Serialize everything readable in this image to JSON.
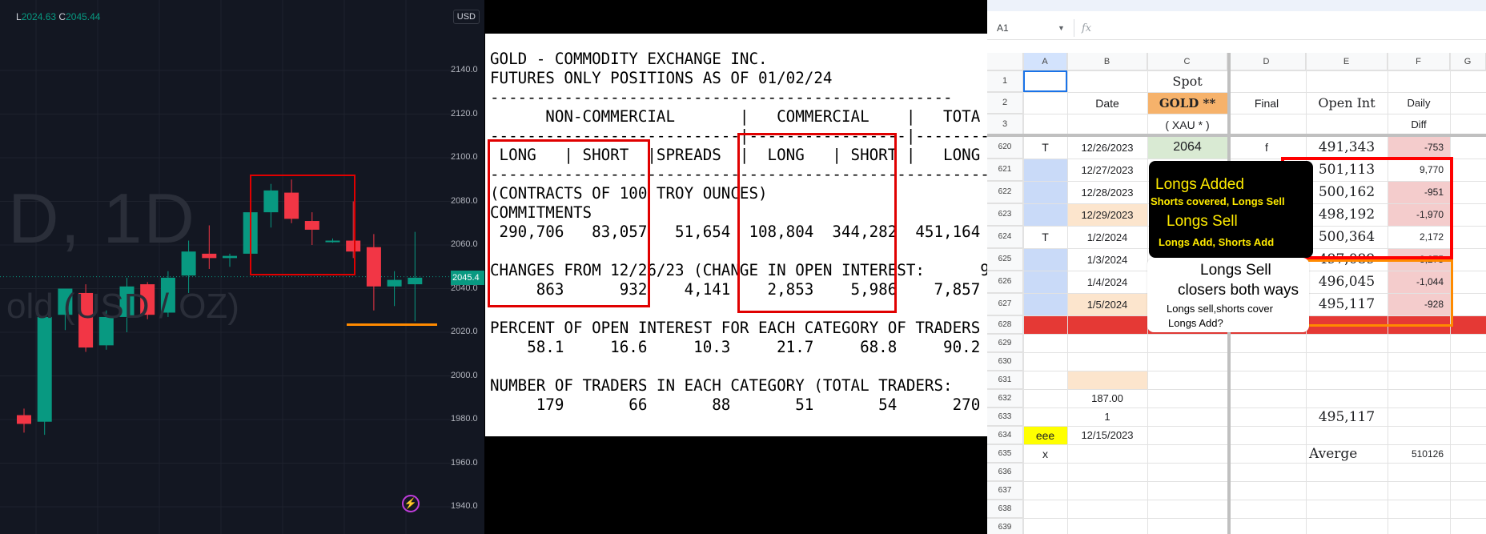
{
  "chart": {
    "ohlc_l_prefix": "L",
    "ohlc_l_value": "2024.63",
    "ohlc_c_prefix": "C",
    "ohlc_c_value": "2045.44",
    "currency": "USD",
    "watermark_symbol": "D, 1D",
    "watermark_desc": "old (USD / OZ)",
    "price_axis": [
      "2140.0",
      "2120.0",
      "2100.0",
      "2080.0",
      "2060.0",
      "2040.0",
      "2020.0",
      "2000.0",
      "1980.0",
      "1960.0",
      "1940.0"
    ],
    "last_price_tag": "2045.4",
    "colors": {
      "up": "#089981",
      "down": "#f23645",
      "background": "#131722",
      "highlight": "#ff8a00"
    },
    "candles": [
      {
        "o": 1982,
        "h": 1985,
        "l": 1974,
        "c": 1978
      },
      {
        "o": 1979,
        "h": 2024,
        "l": 1973,
        "c": 2027
      },
      {
        "o": 2028,
        "h": 2039,
        "l": 2021,
        "c": 2040
      },
      {
        "o": 2038,
        "h": 2042,
        "l": 2011,
        "c": 2013
      },
      {
        "o": 2014,
        "h": 2030,
        "l": 2012,
        "c": 2027
      },
      {
        "o": 2027,
        "h": 2045,
        "l": 2020,
        "c": 2041
      },
      {
        "o": 2042,
        "h": 2043,
        "l": 2026,
        "c": 2028
      },
      {
        "o": 2029,
        "h": 2048,
        "l": 2027,
        "c": 2045
      },
      {
        "o": 2046,
        "h": 2062,
        "l": 2038,
        "c": 2057
      },
      {
        "o": 2056,
        "h": 2069,
        "l": 2049,
        "c": 2054
      },
      {
        "o": 2054,
        "h": 2056,
        "l": 2050,
        "c": 2055
      },
      {
        "o": 2056,
        "h": 2078,
        "l": 2052,
        "c": 2075
      },
      {
        "o": 2075,
        "h": 2088,
        "l": 2068,
        "c": 2085
      },
      {
        "o": 2084,
        "h": 2090,
        "l": 2070,
        "c": 2072
      },
      {
        "o": 2071,
        "h": 2075,
        "l": 2060,
        "c": 2067
      },
      {
        "o": 2062,
        "h": 2063,
        "l": 2061,
        "c": 2062
      },
      {
        "o": 2062,
        "h": 2080,
        "l": 2054,
        "c": 2057
      },
      {
        "o": 2059,
        "h": 2065,
        "l": 2030,
        "c": 2041
      },
      {
        "o": 2041,
        "h": 2048,
        "l": 2032,
        "c": 2044
      },
      {
        "o": 2042,
        "h": 2066,
        "l": 2025,
        "c": 2045
      }
    ]
  },
  "cot": {
    "report_text": "GOLD - COMMODITY EXCHANGE INC.\nFUTURES ONLY POSITIONS AS OF 01/02/24\n--------------------------------------------------\n      NON-COMMERCIAL       |   COMMERCIAL    |   TOTA\n---------------------------|-----------------|--------\n LONG   | SHORT  |SPREADS  |  LONG   | SHORT |   LONG  |\n--------------------------------------------------------\n(CONTRACTS OF 100 TROY OUNCES)                        OP\nCOMMITMENTS\n 290,706   83,057   51,654  108,804  344,282  451,164\n\nCHANGES FROM 12/26/23 (CHANGE IN OPEN INTEREST:      9\n     863      932    4,141    2,853    5,986    7,857\n\nPERCENT OF OPEN INTEREST FOR EACH CATEGORY OF TRADERS\n    58.1     16.6     10.3     21.7     68.8     90.2\n\nNUMBER OF TRADERS IN EACH CATEGORY (TOTAL TRADERS:\n     179       66       88       51       54      270"
  },
  "sheet": {
    "name_box": "A1",
    "fx_label": "fx",
    "columns": [
      "A",
      "B",
      "C",
      "D",
      "E",
      "F",
      "G"
    ],
    "header_rows": [
      {
        "num": "1",
        "c": "Spot"
      },
      {
        "num": "2",
        "b": "Date",
        "c": "GOLD **",
        "d": "Final",
        "e": "Open Int",
        "f": "Daily"
      },
      {
        "num": "3",
        "c": "( XAU * )",
        "f": "Diff"
      }
    ],
    "rows": [
      {
        "num": "620",
        "a": "T",
        "b": "12/26/2023",
        "c": "2064",
        "d": "f",
        "e": "491,343",
        "f": "-753"
      },
      {
        "num": "621",
        "b": "12/27/2023",
        "e": "501,113",
        "f": "9,770"
      },
      {
        "num": "622",
        "b": "12/28/2023",
        "e": "500,162",
        "f": "-951"
      },
      {
        "num": "623",
        "b": "12/29/2023",
        "e": "498,192",
        "f": "-1,970"
      },
      {
        "num": "624",
        "a": "T",
        "b": "1/2/2024",
        "e": "500,364",
        "f": "2,172"
      },
      {
        "num": "625",
        "b": "1/3/2024",
        "e": "497,089",
        "f": "-3,275"
      },
      {
        "num": "626",
        "b": "1/4/2024",
        "e": "496,045",
        "f": "-1,044"
      },
      {
        "num": "627",
        "b": "1/5/2024",
        "e": "495,117",
        "f": "-928"
      },
      {
        "num": "628"
      },
      {
        "num": "629"
      },
      {
        "num": "630"
      },
      {
        "num": "631"
      },
      {
        "num": "632",
        "b": "187.00"
      },
      {
        "num": "633",
        "b": "1",
        "e": "495,117"
      },
      {
        "num": "634",
        "a": "eee",
        "b": "12/15/2023"
      },
      {
        "num": "635",
        "a": "x",
        "e": "Averge",
        "f": "510126"
      },
      {
        "num": "636"
      },
      {
        "num": "637"
      },
      {
        "num": "638"
      },
      {
        "num": "639"
      }
    ],
    "note_black": {
      "line1": "Longs Added",
      "line2": "Shorts covered, Longs Sell",
      "line3": "Longs Sell",
      "line4": "Longs Add, Shorts Add"
    },
    "note_white": {
      "line1": "Longs Sell",
      "line2": "closers both ways",
      "line3": "Longs sell,shorts cover",
      "line4": "Longs Add?"
    }
  }
}
